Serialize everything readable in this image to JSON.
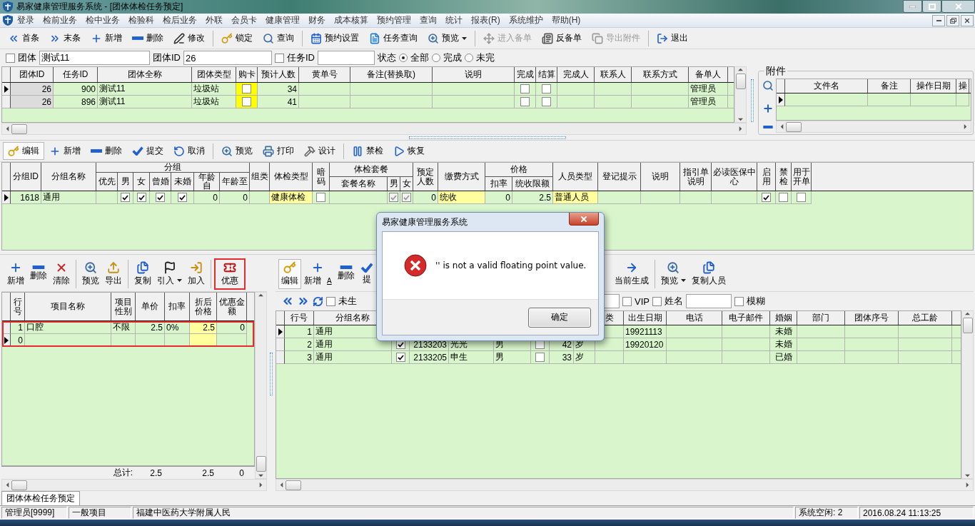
{
  "window": {
    "title": "易家健康管理服务系统 - [团体体检任务预定]"
  },
  "menu": [
    {
      "label": "登录"
    },
    {
      "label": "检前业务"
    },
    {
      "label": "检中业务"
    },
    {
      "label": "检验科"
    },
    {
      "label": "检后业务"
    },
    {
      "label": "外联"
    },
    {
      "label": "会员卡"
    },
    {
      "label": "健康管理"
    },
    {
      "label": "财务"
    },
    {
      "label": "成本核算"
    },
    {
      "label": "预约管理"
    },
    {
      "label": "查询"
    },
    {
      "label": "统计"
    },
    {
      "label": "报表(R)"
    },
    {
      "label": "系统维护"
    },
    {
      "label": "帮助(H)"
    }
  ],
  "toolbar": [
    {
      "label": "首条",
      "disabled": false
    },
    {
      "label": "末条",
      "disabled": false
    },
    {
      "label": "新增",
      "disabled": false
    },
    {
      "label": "删除",
      "disabled": false
    },
    {
      "label": "修改",
      "disabled": false
    },
    {
      "label": "锁定",
      "disabled": false,
      "separator": true
    },
    {
      "label": "查询",
      "disabled": false
    },
    {
      "label": "预约设置",
      "disabled": false,
      "separator": true
    },
    {
      "label": "任务查询",
      "disabled": false
    },
    {
      "label": "预览",
      "disabled": false,
      "dropdown": true
    },
    {
      "label": "进入备单",
      "disabled": true,
      "separator": true
    },
    {
      "label": "反备单",
      "disabled": false
    },
    {
      "label": "导出附件",
      "disabled": true
    },
    {
      "label": "退出",
      "disabled": false,
      "separator": true
    }
  ],
  "filter": {
    "group": {
      "label": "团体",
      "checked": false,
      "value": "测试11"
    },
    "group_id": {
      "label": "团体ID",
      "value": "26"
    },
    "task_id": {
      "label": "任务ID",
      "checked": false
    },
    "status": {
      "label": "状态",
      "options": [
        {
          "label": "全部",
          "selected": true
        },
        {
          "label": "完成",
          "selected": false
        },
        {
          "label": "未完",
          "selected": false
        }
      ]
    }
  },
  "tasks": {
    "columns": [
      {
        "label": "团体ID"
      },
      {
        "label": "任务ID"
      },
      {
        "label": "团体全称"
      },
      {
        "label": "团体类型"
      },
      {
        "label": "购卡"
      },
      {
        "label": "预计人数"
      },
      {
        "label": "黄单号"
      },
      {
        "label": "备注(替换取)"
      },
      {
        "label": "说明"
      },
      {
        "label": "完成"
      },
      {
        "label": "结算"
      },
      {
        "label": "完成人"
      },
      {
        "label": "联系人"
      },
      {
        "label": "联系方式"
      },
      {
        "label": "备单人"
      },
      {}
    ],
    "rows": [
      {
        "current": true,
        "cells": [
          {
            "kind": "key",
            "text": "26"
          },
          {
            "kind": "num",
            "text": "900"
          },
          {
            "kind": "text",
            "text": "测试11"
          },
          {
            "kind": "text",
            "text": "垃圾站"
          },
          {
            "kind": "check",
            "checked": false,
            "highlight": true
          },
          {
            "kind": "num",
            "text": "34"
          },
          {
            "kind": "empty"
          },
          {
            "kind": "empty"
          },
          {
            "kind": "empty"
          },
          {
            "kind": "check",
            "checked": false
          },
          {
            "kind": "check",
            "checked": false
          },
          {
            "kind": "empty"
          },
          {
            "kind": "empty"
          },
          {
            "kind": "empty"
          },
          {
            "kind": "text",
            "text": "管理员"
          },
          {
            "kind": "empty"
          }
        ]
      },
      {
        "current": false,
        "cells": [
          {
            "kind": "key",
            "text": "26"
          },
          {
            "kind": "num",
            "text": "896"
          },
          {
            "kind": "text",
            "text": "测试11"
          },
          {
            "kind": "text",
            "text": "垃圾站"
          },
          {
            "kind": "check",
            "checked": false,
            "highlight": true
          },
          {
            "kind": "num",
            "text": "41"
          },
          {
            "kind": "empty"
          },
          {
            "kind": "empty"
          },
          {
            "kind": "empty"
          },
          {
            "kind": "check",
            "checked": false
          },
          {
            "kind": "check",
            "checked": false
          },
          {
            "kind": "empty"
          },
          {
            "kind": "empty"
          },
          {
            "kind": "empty"
          },
          {
            "kind": "text",
            "text": "管理员"
          },
          {
            "kind": "empty"
          }
        ]
      }
    ]
  },
  "attachments": {
    "title": "附件",
    "columns": [
      {
        "label": "文件名"
      },
      {
        "label": "备注"
      },
      {
        "label": "操作日期"
      },
      {
        "label": "操"
      }
    ],
    "rows": [
      {
        "current": true,
        "cells": [
          {
            "kind": "empty"
          },
          {
            "kind": "empty"
          },
          {
            "kind": "empty"
          },
          {
            "kind": "empty"
          }
        ]
      }
    ]
  },
  "group_toolbar": [
    {
      "label": "编辑",
      "pressed": true
    },
    {
      "label": "新增",
      "pressed": false
    },
    {
      "label": "删除",
      "pressed": false
    },
    {
      "label": "提交",
      "pressed": false
    },
    {
      "label": "取消",
      "pressed": false
    },
    {
      "label": "预览",
      "pressed": false,
      "separator": true
    },
    {
      "label": "打印",
      "pressed": false
    },
    {
      "label": "设计",
      "pressed": false
    },
    {
      "label": "禁检",
      "pressed": false,
      "separator": true
    },
    {
      "label": "恢复",
      "pressed": false
    }
  ],
  "groups": {
    "column_groups": [
      {
        "label": "分组"
      },
      {
        "label": "体检套餐"
      },
      {
        "label": "价格"
      }
    ],
    "columns": [
      {
        "label": "分组ID"
      },
      {
        "label": "分组名称"
      },
      {
        "label": "优先",
        "grouped": true
      },
      {
        "label": "男",
        "grouped": true
      },
      {
        "label": "女",
        "grouped": true
      },
      {
        "label": "曾婚",
        "grouped": true
      },
      {
        "label": "未婚",
        "grouped": true
      },
      {
        "label": "年龄自",
        "grouped": true
      },
      {
        "label": "年龄至",
        "grouped": true
      },
      {
        "label": "组类"
      },
      {
        "label": "体检类型"
      },
      {
        "label": "暗码"
      },
      {
        "label": "套餐名称",
        "grouped": true
      },
      {
        "label": "男",
        "grouped": true
      },
      {
        "label": "女",
        "grouped": true
      },
      {
        "label": "预定人数"
      },
      {
        "label": "缴费方式"
      },
      {
        "label": "扣率",
        "grouped": true
      },
      {
        "label": "统收限额",
        "grouped": true
      },
      {
        "label": "人员类型"
      },
      {
        "label": "登记提示"
      },
      {
        "label": "说明"
      },
      {
        "label": "指引单说明"
      },
      {
        "label": "必读医保中心"
      },
      {
        "label": "启用"
      },
      {
        "label": "禁检"
      },
      {
        "label": "用于开单"
      }
    ],
    "rows": [
      {
        "current": true,
        "cells": [
          {
            "kind": "num",
            "text": "1618"
          },
          {
            "kind": "text",
            "text": "通用"
          },
          {
            "kind": "empty"
          },
          {
            "kind": "check",
            "checked": true,
            "disabled": false
          },
          {
            "kind": "check",
            "checked": true,
            "disabled": false
          },
          {
            "kind": "check",
            "checked": true,
            "disabled": false
          },
          {
            "kind": "check",
            "checked": true,
            "disabled": false
          },
          {
            "kind": "num",
            "text": "0"
          },
          {
            "kind": "num",
            "text": "0"
          },
          {
            "kind": "empty"
          },
          {
            "kind": "text",
            "text": "健康体检",
            "highlight": true
          },
          {
            "kind": "check",
            "checked": false,
            "disabled": false
          },
          {
            "kind": "empty"
          },
          {
            "kind": "check",
            "checked": true,
            "disabled": true
          },
          {
            "kind": "check",
            "checked": true,
            "disabled": true
          },
          {
            "kind": "num",
            "text": "0"
          },
          {
            "kind": "text",
            "text": "统收",
            "highlight": true
          },
          {
            "kind": "num",
            "text": "0"
          },
          {
            "kind": "num",
            "text": "2.5"
          },
          {
            "kind": "text",
            "text": "普通人员",
            "highlight": true
          },
          {
            "kind": "empty"
          },
          {
            "kind": "empty"
          },
          {
            "kind": "empty"
          },
          {
            "kind": "empty"
          },
          {
            "kind": "check",
            "checked": true,
            "disabled": false
          },
          {
            "kind": "check",
            "checked": false,
            "disabled": false
          },
          {
            "kind": "check",
            "checked": false,
            "disabled": false
          }
        ]
      }
    ]
  },
  "item_toolbar": [
    {
      "label": "新增"
    },
    {
      "label": "删除"
    },
    {
      "label": "清除"
    },
    {
      "label": "预览",
      "separator": true
    },
    {
      "label": "导出"
    },
    {
      "label": "复制",
      "separator": true
    },
    {
      "label": "引入",
      "dropdown": true
    },
    {
      "label": "加入"
    },
    {
      "label": "优惠",
      "separator": true,
      "highlighted": true
    }
  ],
  "items": {
    "highlighted": true,
    "columns": [
      {
        "label": "行号"
      },
      {
        "label": "项目名称"
      },
      {
        "label": "项目性别"
      },
      {
        "label": "单价"
      },
      {
        "label": "扣率"
      },
      {
        "label": "折后价格"
      },
      {
        "label": "优惠金额"
      }
    ],
    "rows": [
      {
        "current": false,
        "cells": [
          {
            "kind": "num",
            "text": "1"
          },
          {
            "kind": "text",
            "text": "口腔"
          },
          {
            "kind": "text",
            "text": "不限"
          },
          {
            "kind": "num",
            "text": "2.5"
          },
          {
            "kind": "text",
            "text": "0%"
          },
          {
            "kind": "num",
            "text": "2.5",
            "highlight": true
          },
          {
            "kind": "num",
            "text": "0"
          }
        ]
      },
      {
        "current": true,
        "cells": [
          {
            "kind": "num",
            "text": "0"
          },
          {
            "kind": "empty"
          },
          {
            "kind": "empty"
          },
          {
            "kind": "empty"
          },
          {
            "kind": "empty"
          },
          {
            "kind": "empty",
            "highlight": true
          },
          {
            "kind": "empty"
          }
        ]
      }
    ],
    "totals": {
      "label": "总计:",
      "unit_price": "2.5",
      "discounted": "2.5",
      "discount_amount": "0"
    }
  },
  "people_toolbar": {
    "left": [
      {
        "label": "编辑",
        "pressed": true
      },
      {
        "label": "新增",
        "pressed": false,
        "shortcut": "A"
      },
      {
        "label": "删除",
        "pressed": false
      },
      {
        "label": "提",
        "pressed": false
      }
    ],
    "right": [
      {
        "label": "当前生成",
        "pressed": false
      },
      {
        "label": "预览",
        "pressed": false,
        "separator": true,
        "dropdown": true
      },
      {
        "label": "复制人员",
        "pressed": false
      }
    ]
  },
  "people_filter": {
    "unborn": {
      "label": "未生",
      "checked": false
    },
    "vip": {
      "label": "VIP",
      "checked": false
    },
    "name": {
      "label": "姓名",
      "checked": false
    },
    "fuzzy": {
      "label": "模糊",
      "checked": false
    }
  },
  "people": {
    "columns": [
      {
        "label": "行号"
      },
      {
        "label": "分组名称"
      },
      {},
      {},
      {},
      {},
      {},
      {},
      {},
      {
        "label": "类"
      },
      {
        "label": "出生日期"
      },
      {
        "label": "电话"
      },
      {
        "label": "电子邮件"
      },
      {
        "label": "婚姻"
      },
      {
        "label": "部门"
      },
      {
        "label": "团体序号"
      },
      {
        "label": "总工龄"
      },
      {}
    ],
    "rows": [
      {
        "current": true,
        "cells": [
          {
            "kind": "num",
            "text": "1"
          },
          {
            "kind": "text",
            "text": "通用"
          },
          {
            "kind": "empty"
          },
          {
            "kind": "empty"
          },
          {
            "kind": "empty"
          },
          {
            "kind": "empty"
          },
          {
            "kind": "empty"
          },
          {
            "kind": "empty"
          },
          {
            "kind": "empty"
          },
          {
            "kind": "empty"
          },
          {
            "kind": "text",
            "text": "19921113"
          },
          {
            "kind": "empty"
          },
          {
            "kind": "empty"
          },
          {
            "kind": "center",
            "text": "未婚"
          },
          {
            "kind": "empty"
          },
          {
            "kind": "empty"
          },
          {
            "kind": "empty"
          },
          {
            "kind": "empty"
          }
        ]
      },
      {
        "current": false,
        "cells": [
          {
            "kind": "num",
            "text": "2"
          },
          {
            "kind": "text",
            "text": "通用"
          },
          {
            "kind": "check",
            "checked": true
          },
          {
            "kind": "num",
            "text": "2133203"
          },
          {
            "kind": "text",
            "text": "光光"
          },
          {
            "kind": "text",
            "text": "男"
          },
          {
            "kind": "check",
            "checked": false
          },
          {
            "kind": "num",
            "text": "42"
          },
          {
            "kind": "text",
            "text": "岁"
          },
          {
            "kind": "empty"
          },
          {
            "kind": "text",
            "text": "19920120"
          },
          {
            "kind": "empty"
          },
          {
            "kind": "empty"
          },
          {
            "kind": "center",
            "text": "未婚"
          },
          {
            "kind": "empty"
          },
          {
            "kind": "empty"
          },
          {
            "kind": "empty"
          },
          {
            "kind": "empty"
          }
        ]
      },
      {
        "current": false,
        "cells": [
          {
            "kind": "num",
            "text": "3"
          },
          {
            "kind": "text",
            "text": "通用"
          },
          {
            "kind": "check",
            "checked": true
          },
          {
            "kind": "num",
            "text": "2133205"
          },
          {
            "kind": "text",
            "text": "申生"
          },
          {
            "kind": "text",
            "text": "男"
          },
          {
            "kind": "check",
            "checked": false
          },
          {
            "kind": "num",
            "text": "33"
          },
          {
            "kind": "text",
            "text": "岁"
          },
          {
            "kind": "empty"
          },
          {
            "kind": "empty"
          },
          {
            "kind": "empty"
          },
          {
            "kind": "empty"
          },
          {
            "kind": "center",
            "text": "已婚"
          },
          {
            "kind": "empty"
          },
          {
            "kind": "empty"
          },
          {
            "kind": "empty"
          },
          {
            "kind": "empty"
          }
        ]
      }
    ]
  },
  "tabs": [
    {
      "label": "团体体检任务预定",
      "selected": true
    }
  ],
  "status_bar": [
    "管理员[9999]",
    "一般项目",
    "福建中医药大学附属人民",
    "系统空闲: 2",
    "2016.08.24 11:13:25"
  ],
  "dialog": {
    "title": "易家健康管理服务系统",
    "message": "'' is not a valid floating point value.",
    "button": "确定"
  }
}
